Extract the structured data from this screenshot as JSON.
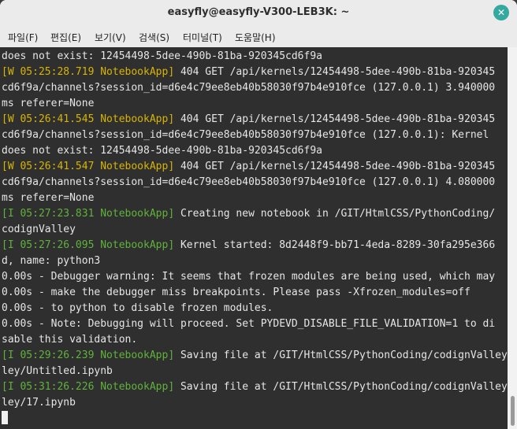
{
  "window": {
    "title": "easyfly@easyfly-V300-LEB3K: ~"
  },
  "menu": [
    "파일(F)",
    "편집(E)",
    "보기(V)",
    "검색(S)",
    "터미널(T)",
    "도움말(H)"
  ],
  "colors": {
    "terminal_bg": "#2f2f2f",
    "text": "#e6e6e6",
    "warn": "#d7b500",
    "info": "#5fb33a"
  },
  "lines": [
    [
      {
        "t": "does not exist: 12454498-5dee-490b-81ba-920345cd6f9a",
        "c": "text"
      }
    ],
    [
      {
        "t": "[W 05:25:28.719 NotebookApp]",
        "c": "warn"
      },
      {
        "t": " 404 GET /api/kernels/12454498-5dee-490b-81ba-920345",
        "c": "text"
      }
    ],
    [
      {
        "t": "cd6f9a/channels?session_id=d6e4c79ee8eb40b58030f97b4e910fce (127.0.0.1) 3.940000",
        "c": "text"
      }
    ],
    [
      {
        "t": "ms referer=None",
        "c": "text"
      }
    ],
    [
      {
        "t": "[W 05:26:41.545 NotebookApp]",
        "c": "warn"
      },
      {
        "t": " 404 GET /api/kernels/12454498-5dee-490b-81ba-920345",
        "c": "text"
      }
    ],
    [
      {
        "t": "cd6f9a/channels?session_id=d6e4c79ee8eb40b58030f97b4e910fce (127.0.0.1): Kernel",
        "c": "text"
      }
    ],
    [
      {
        "t": "does not exist: 12454498-5dee-490b-81ba-920345cd6f9a",
        "c": "text"
      }
    ],
    [
      {
        "t": "[W 05:26:41.547 NotebookApp]",
        "c": "warn"
      },
      {
        "t": " 404 GET /api/kernels/12454498-5dee-490b-81ba-920345",
        "c": "text"
      }
    ],
    [
      {
        "t": "cd6f9a/channels?session_id=d6e4c79ee8eb40b58030f97b4e910fce (127.0.0.1) 4.080000",
        "c": "text"
      }
    ],
    [
      {
        "t": "ms referer=None",
        "c": "text"
      }
    ],
    [
      {
        "t": "[I 05:27:23.831 NotebookApp]",
        "c": "info"
      },
      {
        "t": " Creating new notebook in /GIT/HtmlCSS/PythonCoding/",
        "c": "text"
      }
    ],
    [
      {
        "t": "codignValley",
        "c": "text"
      }
    ],
    [
      {
        "t": "[I 05:27:26.095 NotebookApp]",
        "c": "info"
      },
      {
        "t": " Kernel started: 8d2448f9-bb71-4eda-8289-30fa295e366",
        "c": "text"
      }
    ],
    [
      {
        "t": "d, name: python3",
        "c": "text"
      }
    ],
    [
      {
        "t": "0.00s - Debugger warning: It seems that frozen modules are being used, which may",
        "c": "text"
      }
    ],
    [
      {
        "t": "0.00s - make the debugger miss breakpoints. Please pass -Xfrozen_modules=off",
        "c": "text"
      }
    ],
    [
      {
        "t": "0.00s - to python to disable frozen modules.",
        "c": "text"
      }
    ],
    [
      {
        "t": "0.00s - Note: Debugging will proceed. Set PYDEVD_DISABLE_FILE_VALIDATION=1 to di",
        "c": "text"
      }
    ],
    [
      {
        "t": "sable this validation.",
        "c": "text"
      }
    ],
    [
      {
        "t": "[I 05:29:26.239 NotebookApp]",
        "c": "info"
      },
      {
        "t": " Saving file at /GIT/HtmlCSS/PythonCoding/codignValley/",
        "c": "text"
      }
    ],
    [
      {
        "t": "ley/Untitled.ipynb",
        "c": "text"
      }
    ],
    [
      {
        "t": "[I 05:31:26.226 NotebookApp]",
        "c": "info"
      },
      {
        "t": " Saving file at /GIT/HtmlCSS/PythonCoding/codignValley/",
        "c": "text"
      }
    ],
    [
      {
        "t": "ley/17.ipynb",
        "c": "text"
      }
    ]
  ]
}
